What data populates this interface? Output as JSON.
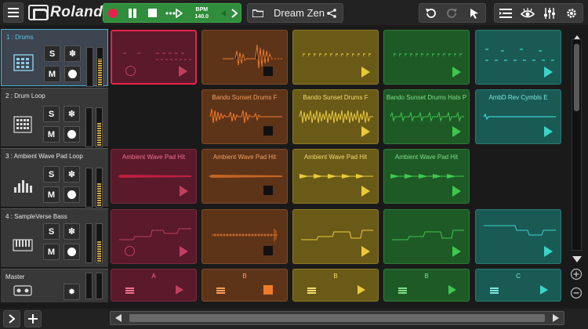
{
  "app": {
    "brand": "Roland"
  },
  "transport": {
    "bpm_label": "BPM",
    "bpm_value": "140.0"
  },
  "song": {
    "title": "Dream Zen"
  },
  "tracks": [
    {
      "name": "1 : Drums",
      "solo": "S",
      "mute": "M",
      "selected": true,
      "icon": "drum-machine-icon"
    },
    {
      "name": "2 : Drum Loop",
      "solo": "S",
      "mute": "M",
      "icon": "drum-pads-icon"
    },
    {
      "name": "3 : Ambient Wave Pad Loop",
      "solo": "S",
      "mute": "M",
      "icon": "level-bars-icon"
    },
    {
      "name": "4 : SampleVerse Bass",
      "solo": "S",
      "mute": "M",
      "icon": "keyboard-icon"
    }
  ],
  "master": {
    "name": "Master"
  },
  "clips": {
    "row2": [
      "Bando Sunset Drums F",
      "Bando Sunset Drums F",
      "Bando Sunset Drums Hats P",
      "AmbD Rev Cymbls E"
    ],
    "row3": [
      "Ambient Wave Pad Hit",
      "Ambient Wave Pad Hit",
      "Ambient Wave Pad Hit",
      "Ambient Wave Pad Hit"
    ]
  },
  "scenes": [
    "A",
    "B",
    "B",
    "B",
    "C"
  ],
  "colors": {
    "red": "#e8224b",
    "orange": "#f07a2a",
    "yellow": "#e8c93a",
    "green": "#3ec74f",
    "teal": "#3ad4c8",
    "accent": "#4ab0d8"
  }
}
